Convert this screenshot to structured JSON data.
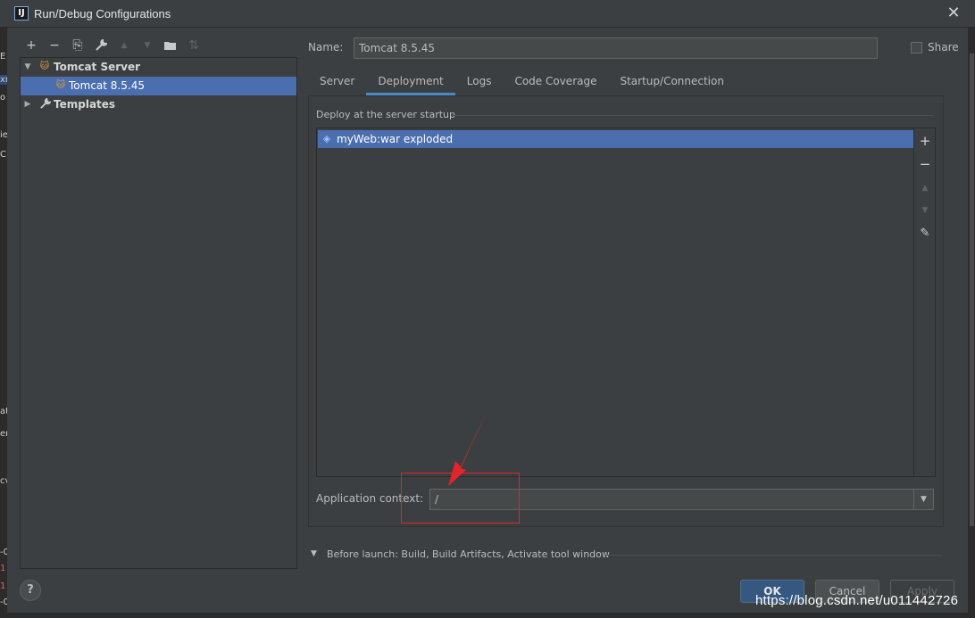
{
  "window": {
    "title": "Run/Debug Configurations",
    "app_icon": "IJ"
  },
  "toolbar": {
    "items": [
      {
        "name": "add-icon",
        "glyph": "+",
        "enabled": true
      },
      {
        "name": "remove-icon",
        "glyph": "−",
        "enabled": true
      },
      {
        "name": "copy-icon",
        "glyph": "⎘",
        "enabled": true
      },
      {
        "name": "wrench-icon",
        "glyph": "🔧",
        "enabled": true
      },
      {
        "name": "move-up-icon",
        "glyph": "▲",
        "enabled": false
      },
      {
        "name": "move-down-icon",
        "glyph": "▼",
        "enabled": false
      },
      {
        "name": "folder-add-icon",
        "glyph": "▆",
        "enabled": true
      },
      {
        "name": "sort-icon",
        "glyph": "⇅",
        "enabled": false
      }
    ]
  },
  "tree": {
    "tomcat_server": "Tomcat Server",
    "tomcat_instance": "Tomcat 8.5.45",
    "templates": "Templates"
  },
  "form": {
    "name_label": "Name:",
    "name_value": "Tomcat 8.5.45",
    "share_label": "Share"
  },
  "tabs": [
    "Server",
    "Deployment",
    "Logs",
    "Code Coverage",
    "Startup/Connection"
  ],
  "active_tab": "Deployment",
  "deployment": {
    "caption": "Deploy at the server startup",
    "items": [
      "myWeb:war exploded"
    ],
    "side_buttons": [
      "+",
      "−",
      "▲",
      "▼",
      "✎"
    ],
    "context_label": "Application context:",
    "context_value": "/"
  },
  "before_launch": "Before launch: Build, Build Artifacts, Activate tool window",
  "buttons": {
    "help": "?",
    "ok": "OK",
    "cancel": "Cancel",
    "apply": "Apply"
  },
  "watermark": "https://blog.csdn.net/u011442726",
  "background_fragments": [
    "E",
    "xn",
    "o",
    "ie",
    "C",
    "at",
    "er",
    "cv",
    "-0",
    "1",
    "1",
    "-0"
  ],
  "colors": {
    "selection": "#4b6eaf",
    "accent": "#4a88c7",
    "ok_button": "#365880",
    "annotation": "#e5232b"
  }
}
